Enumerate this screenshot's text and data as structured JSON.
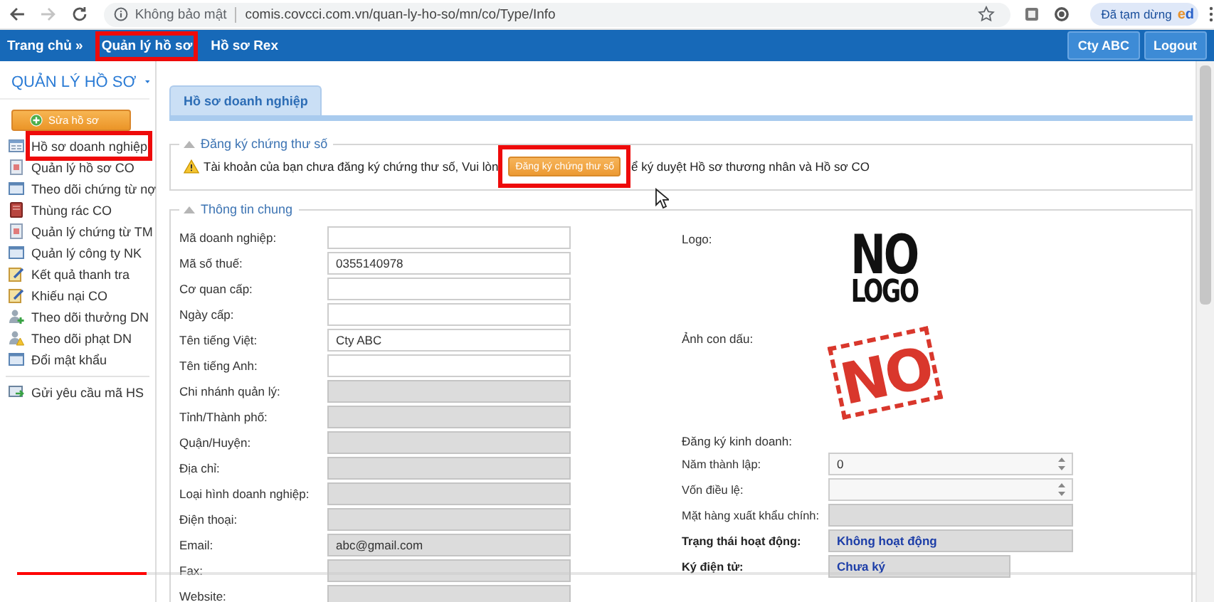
{
  "browser": {
    "nav_buttons": [
      {
        "kind": "back",
        "disabled": false
      },
      {
        "kind": "forward",
        "disabled": true
      },
      {
        "kind": "reload",
        "disabled": false
      }
    ],
    "security_label": "Không bảo mật",
    "url": "comis.covcci.com.vn/quan-ly-ho-so/mn/co/Type/Info",
    "profile": {
      "status": "Đã tạm dừng",
      "avatar": "ed"
    }
  },
  "nav": {
    "items": [
      {
        "label": "Trang chủ »",
        "highlighted": false
      },
      {
        "label": "Quản lý hồ sơ",
        "highlighted": true
      },
      {
        "label": "Hồ sơ Rex",
        "highlighted": false
      }
    ],
    "account_buttons": [
      "Cty ABC",
      "Logout"
    ]
  },
  "sidebar": {
    "title": "QUẢN LÝ HỒ SƠ",
    "edit_button": "Sửa hồ sơ",
    "items": [
      {
        "label": "Hồ sơ doanh nghiệp",
        "kind": "form",
        "highlighted": true
      },
      {
        "label": "Quản lý hồ sơ CO",
        "kind": "document",
        "highlighted": false
      },
      {
        "label": "Theo dõi chứng từ nợ",
        "kind": "window",
        "highlighted": false
      },
      {
        "label": "Thùng rác CO",
        "kind": "trash",
        "highlighted": false
      },
      {
        "label": "Quản lý chứng từ TM",
        "kind": "document",
        "highlighted": false
      },
      {
        "label": "Quản lý công ty NK",
        "kind": "window",
        "highlighted": false
      },
      {
        "label": "Kết quả thanh tra",
        "kind": "edit",
        "highlighted": false
      },
      {
        "label": "Khiếu nại CO",
        "kind": "edit",
        "highlighted": false
      },
      {
        "label": "Theo dõi thưởng DN",
        "kind": "reward",
        "highlighted": false
      },
      {
        "label": "Theo dõi phạt DN",
        "kind": "penalty",
        "highlighted": false
      },
      {
        "label": "Đổi mật khẩu",
        "kind": "window",
        "highlighted": false
      }
    ],
    "footer_items": [
      {
        "label": "Gửi yêu cầu mã HS",
        "kind": "send",
        "highlighted": false
      }
    ]
  },
  "tabs": [
    {
      "label": "Hồ sơ doanh nghiệp",
      "selected": true
    }
  ],
  "certificate": {
    "legend": "Đăng ký chứng thư số",
    "message_start": "Tài khoản của bạn chưa đăng ký chứng thư số, Vui lòn",
    "button": {
      "label": "Đăng ký chứng thư số",
      "highlighted": true
    },
    "message_end": "ể ký duyệt Hồ sơ thương nhân và Hồ sơ CO"
  },
  "general": {
    "legend": "Thông tin chung",
    "left_fields": [
      {
        "label": "Mã doanh nghiệp:",
        "disabled": false
      },
      {
        "label": "Mã số thuế:",
        "value": "0355140978",
        "disabled": false
      },
      {
        "label": "Cơ quan cấp:",
        "disabled": false
      },
      {
        "label": "Ngày cấp:",
        "disabled": false
      },
      {
        "label": "Tên tiếng Việt:",
        "value": "Cty ABC",
        "disabled": false
      },
      {
        "label": "Tên tiếng Anh:",
        "disabled": false
      },
      {
        "label": "Chi nhánh quản lý:",
        "disabled": true
      },
      {
        "label": "Tỉnh/Thành phố:",
        "disabled": true
      },
      {
        "label": "Quận/Huyện:",
        "disabled": true
      },
      {
        "label": "Địa chỉ:",
        "disabled": true
      },
      {
        "label": "Loại hình doanh nghiệp:",
        "disabled": true
      },
      {
        "label": "Điện thoại:",
        "disabled": true
      },
      {
        "label": "Email:",
        "value": "abc@gmail.com",
        "disabled": true
      },
      {
        "label": "Fax:",
        "disabled": true
      },
      {
        "label": "Website:",
        "disabled": true
      }
    ],
    "logo": {
      "label": "Logo:",
      "image_text": [
        "NO",
        "LOGO"
      ]
    },
    "stamp": {
      "label": "Ảnh con dấu:",
      "image_text": "NO"
    },
    "registration_heading": "Đăng ký kinh doanh:",
    "right_fields": [
      {
        "label": "Năm thành lập:",
        "value": "0",
        "kind": "spinner"
      },
      {
        "label": "Vốn điều lệ:",
        "kind": "spinner"
      },
      {
        "label": "Mặt hàng xuất khẩu chính:",
        "kind": "text"
      },
      {
        "label": "Trạng thái hoạt động:",
        "value": "Không hoạt động",
        "kind": "status"
      },
      {
        "label": "Ký điện tử:",
        "value": "Chưa ký",
        "kind": "signature"
      }
    ]
  },
  "video_player": {
    "progress": {
      "level": 0.11
    }
  }
}
